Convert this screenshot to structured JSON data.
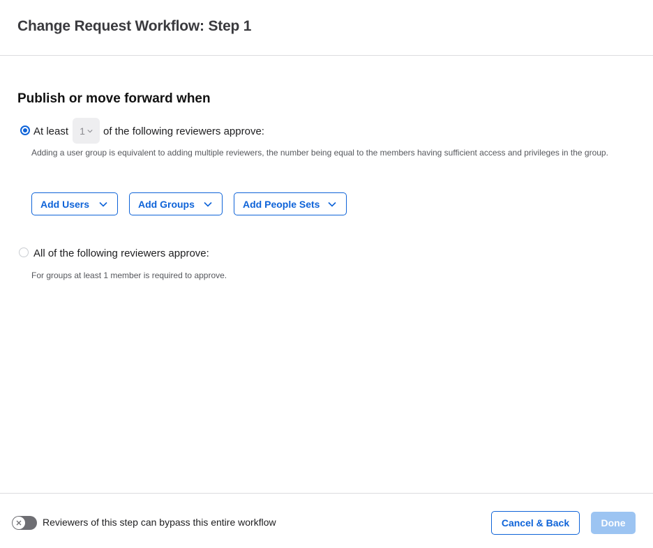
{
  "dialog": {
    "title": "Change Request Workflow: Step 1"
  },
  "section": {
    "title": "Publish or move forward when"
  },
  "option_at_least": {
    "selected": true,
    "prefix": "At least",
    "count_value": "1",
    "suffix": "of the following reviewers approve:",
    "helper": "Adding a user group is equivalent to adding multiple reviewers, the number being equal to the members having sufficient access and privileges in the group."
  },
  "add_buttons": {
    "users": "Add Users",
    "groups": "Add Groups",
    "people_sets": "Add People Sets"
  },
  "option_all": {
    "selected": false,
    "label": "All of the following reviewers approve:",
    "helper": "For groups at least 1 member is required to approve."
  },
  "footer": {
    "bypass_toggle_on": false,
    "bypass_label": "Reviewers of this step can bypass this entire workflow",
    "cancel_label": "Cancel & Back",
    "done_label": "Done",
    "done_enabled": false
  },
  "colors": {
    "accent": "#0e63d8",
    "done_disabled": "#9cc4f2",
    "toggle_off": "#6e6e73"
  }
}
